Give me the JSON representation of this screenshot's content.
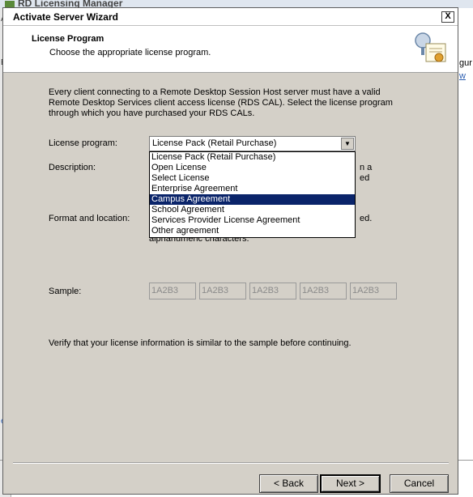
{
  "background_app": {
    "title": "RD Licensing Manager",
    "left_fragments": [
      "A",
      "E",
      "er"
    ],
    "right_fragments": [
      "gur"
    ],
    "right_link": "w"
  },
  "wizard": {
    "title": "Activate Server Wizard",
    "close_label": "X",
    "header": {
      "title": "License Program",
      "subtitle": "Choose the appropriate license program."
    },
    "intro": "Every client connecting to a Remote Desktop Session Host server must have a valid Remote Desktop Services client access license (RDS CAL). Select the license program through which you have purchased your RDS CALs.",
    "license_program": {
      "label": "License program:",
      "value": "License Pack (Retail Purchase)",
      "arrow": "▼",
      "options": [
        "License Pack (Retail Purchase)",
        "Open License",
        "Select License",
        "Enterprise Agreement",
        "Campus Agreement",
        "School Agreement",
        "Services Provider License Agreement",
        "Other agreement"
      ],
      "highlighted_option": "Campus Agreement"
    },
    "description": {
      "label": "Description:",
      "fragments": [
        "n a",
        "ed"
      ]
    },
    "format": {
      "label": "Format and location:",
      "fragment_right": "ed.",
      "fragment_below": "alphanumeric characters."
    },
    "sample": {
      "label": "Sample:",
      "boxes": [
        "1A2B3",
        "1A2B3",
        "1A2B3",
        "1A2B3",
        "1A2B3"
      ]
    },
    "verify_text": "Verify that your license information is similar to the sample before continuing.",
    "buttons": {
      "back": "< Back",
      "next": "Next >",
      "cancel": "Cancel"
    }
  }
}
